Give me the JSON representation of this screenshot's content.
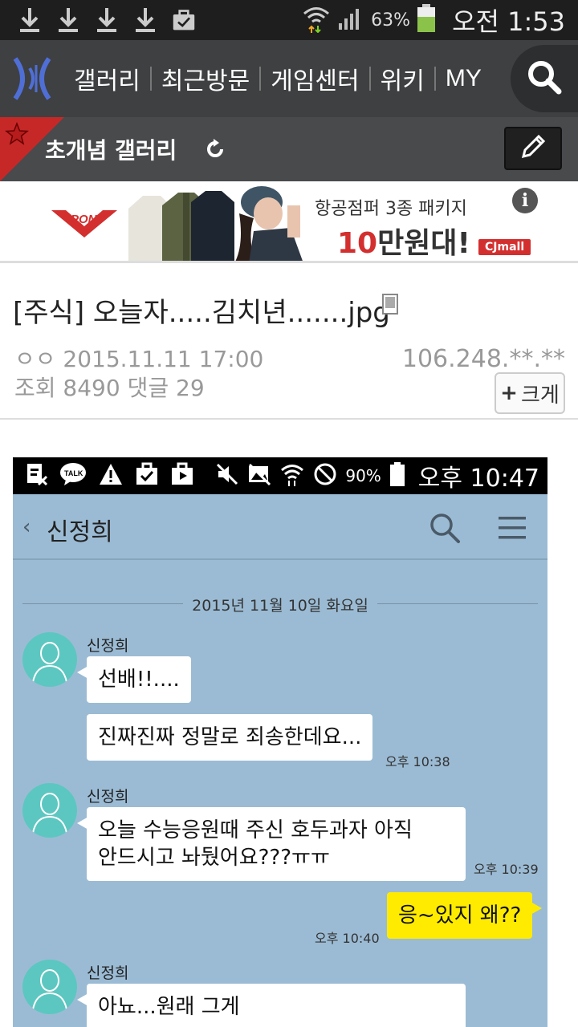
{
  "status_bar": {
    "battery_pct": "63%",
    "time": "오전 1:53",
    "icons": [
      "download-icon",
      "download-icon",
      "download-icon",
      "download-icon",
      "clipboard-check-icon",
      "wifi-icon",
      "signal-icon",
      "battery-icon"
    ]
  },
  "nav": {
    "items": [
      "갤러리",
      "최근방문",
      "게임센터",
      "위키",
      "MY"
    ]
  },
  "gallery": {
    "title": "초개념 갤러리"
  },
  "ad": {
    "brand": "PONY",
    "headline": "항공점퍼 3종 패키지",
    "price_num": "10",
    "price_rest": "만원대!",
    "mall": "CJmall",
    "info": "i"
  },
  "post": {
    "title": "[주식] 오늘자.....김치년.......jpg",
    "author_date": "ㅇㅇ 2015.11.11 17:00",
    "views_comments": "조회 8490 댓글 29",
    "ip": "106.248.**.**",
    "enlarge_label": "크게",
    "enlarge_plus": "+"
  },
  "screenshot": {
    "status": {
      "battery_pct": "90%",
      "time": "오후 10:47"
    },
    "chat": {
      "contact": "신정희",
      "back": "‹",
      "date": "2015년 11월 10일 화요일",
      "messages": [
        {
          "sender": "신정희",
          "text": "선배!!....",
          "time": ""
        },
        {
          "sender": "",
          "text": "진짜진짜 정말로 죄송한데요...",
          "time": "오후 10:38"
        },
        {
          "sender": "신정희",
          "text_line1": "오늘 수능응원때 주신 호두과자 아직",
          "text_line2": "안드시고 놔뒀어요???ㅠㅠ",
          "time": "오후 10:39"
        },
        {
          "sender": "me",
          "text": "응~있지 왜??",
          "time": "오후 10:40"
        },
        {
          "sender": "신정희",
          "text_line1": "아뇨...원래 그게",
          "text_line2": "",
          "time": ""
        }
      ]
    }
  },
  "colors": {
    "nav_bg": "#3e4042",
    "gallery_bg": "#484a4c",
    "chat_bg": "#9bbbd4",
    "my_bubble": "#ffeb00",
    "avatar": "#5cc7c0"
  }
}
